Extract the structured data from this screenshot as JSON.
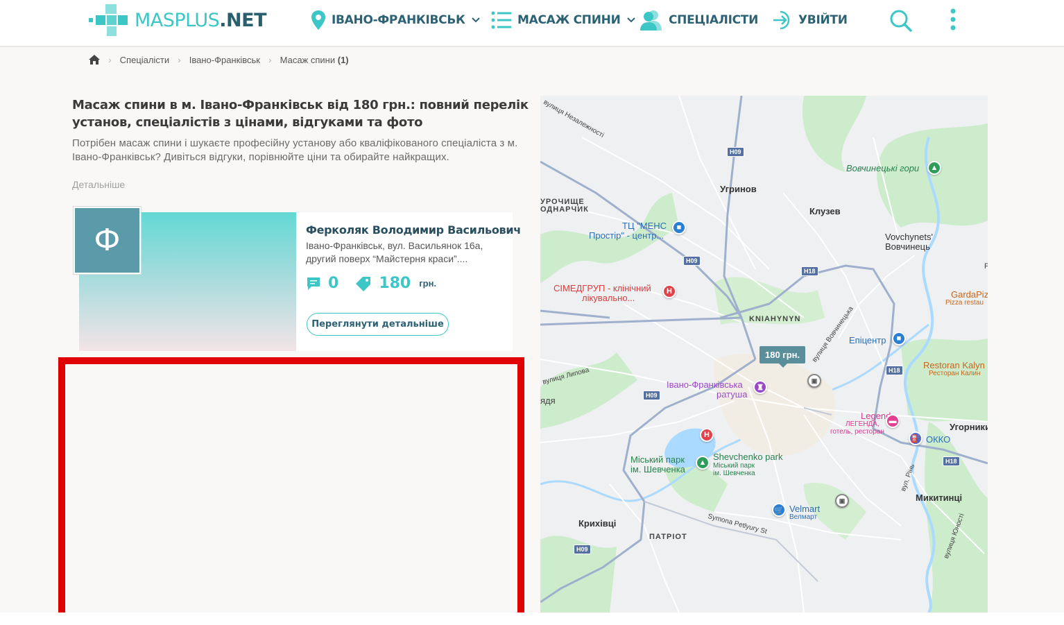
{
  "header": {
    "logo_mas": "MASPLUS",
    "logo_net": ".NET",
    "nav": [
      {
        "label": "Івано-Франківськ"
      },
      {
        "label": "Масаж спини"
      },
      {
        "label": "Спеціалісти"
      },
      {
        "label": "Увійти"
      }
    ]
  },
  "breadcrumb": {
    "items": [
      "Спеціалісти",
      "Івано-Франківськ",
      "Масаж спини"
    ],
    "count": "(1)"
  },
  "page": {
    "title": "Масаж спини в м. Івано-Франківськ від 180 грн.: повний перелік установ, спеціалістів з цінами, відгуками та фото",
    "description": "Потрібен масаж спини і шукаєте професійну установу або кваліфікованого спеціаліста з м. Івано-Франківськ? Дивіться відгуки, порівнюйте ціни та обирайте найкращих.",
    "more_link": "Детальніше"
  },
  "card": {
    "avatar_letter": "Ф",
    "name": "Ферколяк Володимир Васильович",
    "address": "Івано-Франківськ, вул. Васильянок 16а, другий поверх “Майстерня краси”....",
    "reviews": "0",
    "price": "180",
    "price_unit": "грн.",
    "button": "Переглянути детальніше"
  },
  "map": {
    "price_pin": "180 грн.",
    "labels": {
      "vul_nezalezhnosti": "вулиця Незалежності",
      "vovchynetski_hory": "Вовчинецькі гори",
      "uhrynov": "Угринов",
      "kluzev": "Клузев",
      "urochyshche": "УРОЧИЩЕ",
      "odnarchyk": "ОДНАРЧИК",
      "tc_mens_1": "ТЦ \"МЕНС",
      "tc_mens_2": "Простір\" - центр...",
      "vovchynets_1": "Vovchynets'",
      "vovchynets_2": "Вовчинець",
      "simedgrup_1": "СІМЕДГРУП - клінічний",
      "simedgrup_2": "лікувально...",
      "gardapiz": "GardaPiz",
      "pizza_restau": "Pizza restau",
      "kniahynyn": "KNIAHYNYN",
      "vul_vovchynetska": "вулиця Вовчинецька",
      "epitsentr": "Епіцентр",
      "vul_lypova": "вулиця Липова",
      "restoran_kalyn_1": "Restoran Kalyn",
      "restoran_kalyn_2": "Ресторан Калин",
      "ratusha_1": "Івано-Франківська",
      "ratusha_2": "ратуша",
      "legend_1": "Legend",
      "legend_2": "ЛЕГЕНДА,",
      "legend_3": "готель, ресторан",
      "uhornyky": "Угорники",
      "okko": "ОККО",
      "park_1": "Міський парк",
      "park_2": "ім. Шевченка",
      "shevchenko_1": "Shevchenko park",
      "shevchenko_2": "Міський парк",
      "shevchenko_3": "ім. Шевченка",
      "vul_rin": "вул. Рінь",
      "mykytyntsi": "Микитинці",
      "krykhivtsi": "Крихівці",
      "velmart_1": "Velmart",
      "velmart_2": "Велмарт",
      "patriot": "ПАТРІОТ",
      "symona": "Symona Petlyury St",
      "vul_yunosti": "вулиця Юності",
      "vdya": "ядя",
      "r_label": "Р"
    },
    "roads": [
      "H09",
      "H09",
      "H18",
      "H18",
      "H09",
      "H18",
      "H09"
    ]
  },
  "colors": {
    "accent": "#3cc6c6",
    "brand_dark": "#2d6274",
    "highlight_box": "#e00000",
    "map_pin": "#5b8e9b"
  }
}
